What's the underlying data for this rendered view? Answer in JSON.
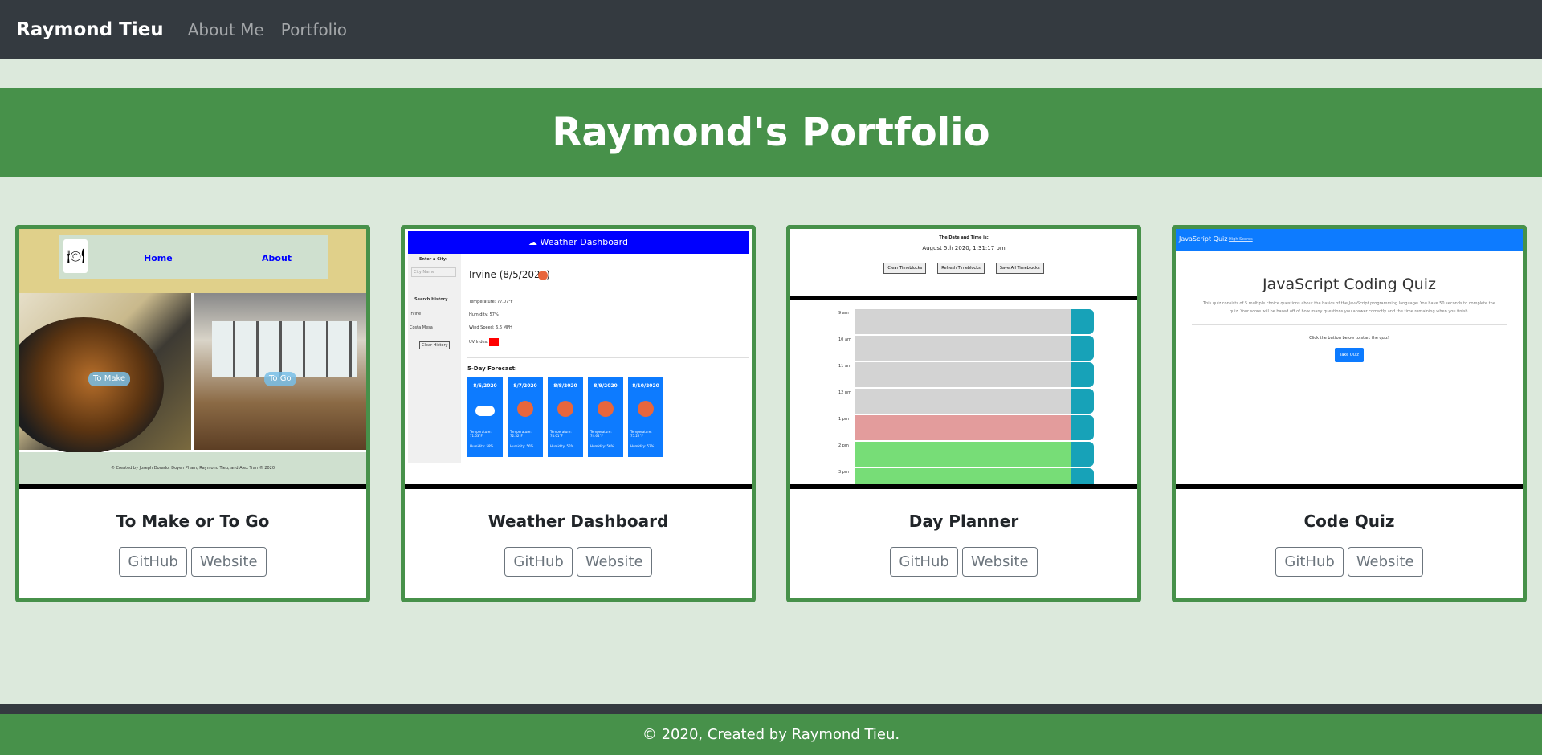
{
  "navbar": {
    "brand": "Raymond Tieu",
    "links": [
      "About Me",
      "Portfolio"
    ]
  },
  "header": {
    "title": "Raymond's Portfolio"
  },
  "projects": [
    {
      "title": "To Make or To Go",
      "github_label": "GitHub",
      "website_label": "Website",
      "thumb": {
        "nav_home": "Home",
        "nav_about": "About",
        "btn_make": "To Make",
        "btn_go": "To Go",
        "footer": "© Created by Joseph Dorado, Doyen Pham, Raymond Tieu, and Alex Tran © 2020"
      }
    },
    {
      "title": "Weather Dashboard",
      "github_label": "GitHub",
      "website_label": "Website",
      "thumb": {
        "header": "☁ Weather Dashboard",
        "enter_city": "Enter a City:",
        "city_placeholder": "City Name",
        "search_history": "Search History",
        "history_1": "Irvine",
        "history_2": "Costa Mesa",
        "clear_history": "Clear History",
        "city": "Irvine (8/5/2020)",
        "temperature": "Temperature: 77.07°F",
        "humidity": "Humidity: 57%",
        "wind": "Wind Speed: 6.6 MPH",
        "uv": "UV Index:",
        "forecast_title": "5-Day Forecast:",
        "days": [
          {
            "date": "8/6/2020",
            "temp": "Temperature: 71.53°F",
            "hum": "Humidity: 58%"
          },
          {
            "date": "8/7/2020",
            "temp": "Temperature: 72.32°F",
            "hum": "Humidity: 56%"
          },
          {
            "date": "8/8/2020",
            "temp": "Temperature: 74.01°F",
            "hum": "Humidity: 55%"
          },
          {
            "date": "8/9/2020",
            "temp": "Temperature: 74.64°F",
            "hum": "Humidity: 56%"
          },
          {
            "date": "8/10/2020",
            "temp": "Temperature: 75.22°F",
            "hum": "Humidity: 52%"
          }
        ]
      }
    },
    {
      "title": "Day Planner",
      "github_label": "GitHub",
      "website_label": "Website",
      "thumb": {
        "title": "The Date and Time is:",
        "date": "August 5th 2020, 1:31:17 pm",
        "btn_clear": "Clear Timeblocks",
        "btn_refresh": "Refresh Timeblocks",
        "btn_save": "Save All Timeblocks",
        "hours": [
          "9 am",
          "10 am",
          "11 am",
          "12 pm",
          "1 pm",
          "2 pm",
          "3 pm"
        ]
      }
    },
    {
      "title": "Code Quiz",
      "github_label": "GitHub",
      "website_label": "Website",
      "thumb": {
        "brand": "JavaScript Quiz",
        "link": "High Scores",
        "title": "JavaScript Coding Quiz",
        "desc": "This quiz consists of 5 multiple choice questions about the basics of the JavaScript programming language. You have 50 seconds to complete the quiz. Your score will be based off of how many questions you answer correctly and the time remaining when you finish.",
        "prompt": "Click the button below to start the quiz!",
        "button": "Take Quiz"
      }
    }
  ],
  "footer": {
    "text": "© 2020, Created by Raymond Tieu."
  },
  "colors": {
    "navbar": "#343a40",
    "accent_green": "#47914a",
    "page_bg": "#dce9dc"
  }
}
